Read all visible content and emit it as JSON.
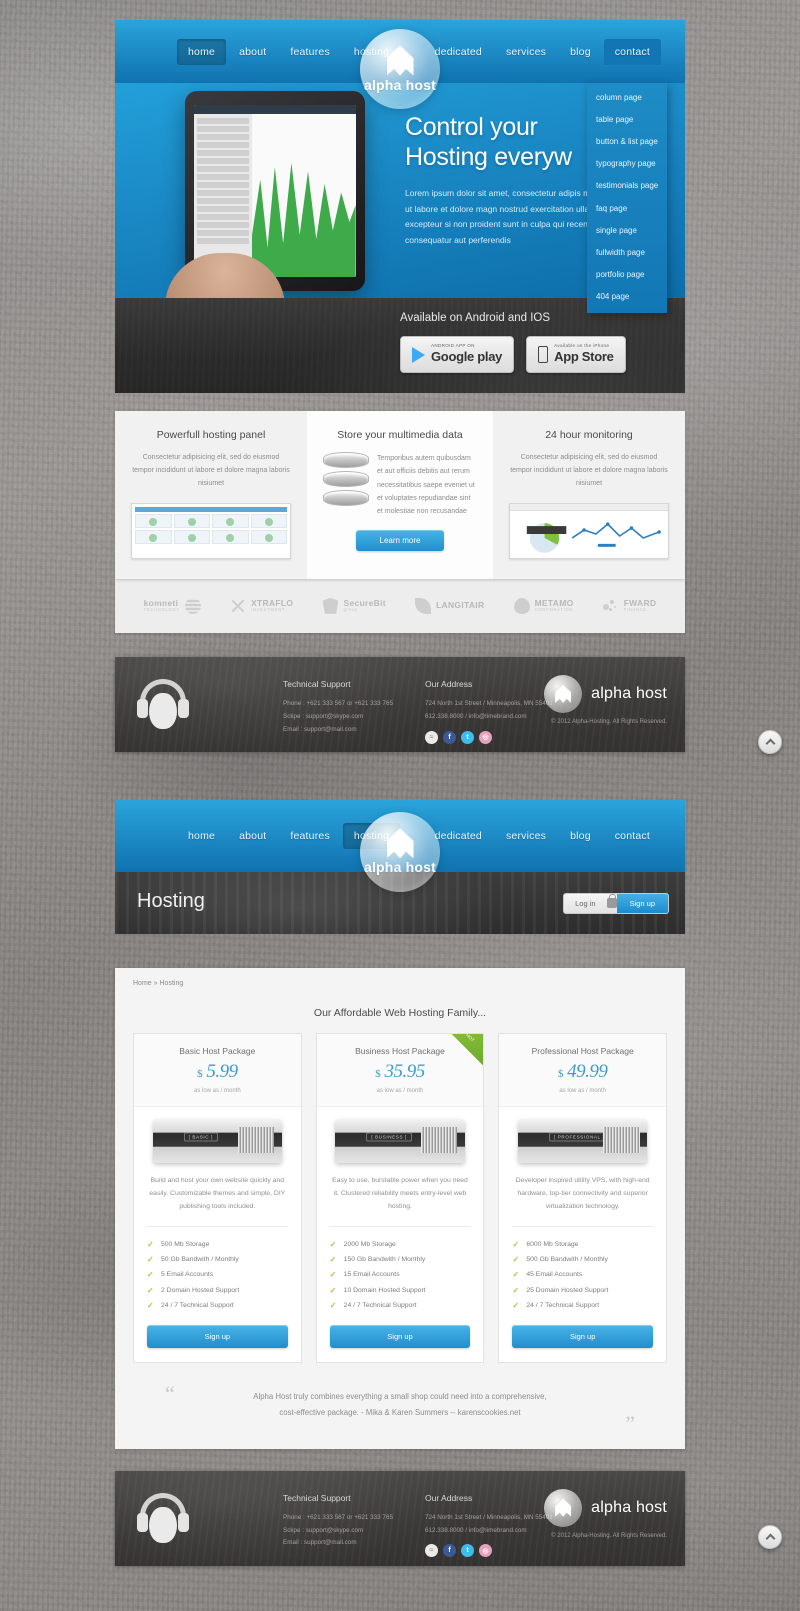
{
  "brand": {
    "name": "alpha host",
    "logo_icon": "alpha-host-logo-icon"
  },
  "nav": {
    "left": [
      {
        "label": "home",
        "state": "active"
      },
      {
        "label": "about",
        "state": ""
      },
      {
        "label": "features",
        "state": ""
      },
      {
        "label": "hosting",
        "state": ""
      }
    ],
    "right": [
      {
        "label": "dedicated",
        "state": ""
      },
      {
        "label": "services",
        "state": ""
      },
      {
        "label": "blog",
        "state": ""
      },
      {
        "label": "contact",
        "state": "open"
      }
    ],
    "dropdown": [
      "column page",
      "table page",
      "button & list page",
      "typography page",
      "testimonials page",
      "faq page",
      "single page",
      "fullwidth page",
      "portfolio page",
      "404 page"
    ]
  },
  "nav2": {
    "left": [
      {
        "label": "home",
        "state": ""
      },
      {
        "label": "about",
        "state": ""
      },
      {
        "label": "features",
        "state": ""
      },
      {
        "label": "hosting",
        "state": "active"
      }
    ],
    "right": [
      {
        "label": "dedicated",
        "state": ""
      },
      {
        "label": "services",
        "state": ""
      },
      {
        "label": "blog",
        "state": ""
      },
      {
        "label": "contact",
        "state": ""
      }
    ]
  },
  "hero": {
    "title_line1": "Control your",
    "title_line2": "Hosting everyw",
    "paragraph": "Lorem ipsum dolor sit amet, consectetur adipis mod tempor incididunt ut labore et dolore magn nostrud exercitation ullamco laboris excepteur si non proident sunt in culpa qui recends volupta consequatur aut perferendis",
    "prev_arrow": "‹",
    "next_arrow": "›"
  },
  "appbar": {
    "title": "Available on Android and IOS",
    "google_play": {
      "small": "ANDROID APP ON",
      "big": "Google play"
    },
    "app_store": {
      "small": "Available on the iPhone",
      "big": "App Store"
    }
  },
  "features": [
    {
      "title": "Powerfull hosting panel",
      "body": "Consectetur adipisicing elit, sed do eiusmod tempor incididunt ut labore et dolore magna laboris nisiumet"
    },
    {
      "title": "Store your multimedia data",
      "body": "Temporibus autem quibusdam et aut officiis debitis aut rerum necessitatibus saepe eveniet ut et voluptates repudiandae sint et molestiae non recusandae",
      "button": "Learn more"
    },
    {
      "title": "24 hour monitoring",
      "body": "Consectetur adipisicing elit, sed do eiusmod tempor incididunt ut labore et dolore magna laboris nisiumet"
    }
  ],
  "partners": [
    {
      "name": "komneti",
      "sub": "TECHNOLOGY",
      "icon": "globe-icon"
    },
    {
      "name": "XTRAFLO",
      "sub": "INVESTMENT",
      "icon": "x-cross-icon"
    },
    {
      "name": "SecureBit",
      "sub": "group",
      "icon": "shield-icon"
    },
    {
      "name": "LANGITAIR",
      "sub": "",
      "icon": "leaf-icon"
    },
    {
      "name": "METAMO",
      "sub": "CORPORATION",
      "icon": "flame-icon"
    },
    {
      "name": "FWARD",
      "sub": "FINANCE",
      "icon": "dots-icon"
    }
  ],
  "footer": {
    "support": {
      "heading": "Technical Support",
      "lines": [
        "Phone : +621 333 567 or +621 333 765",
        "Sckpe : support@skype.com",
        "Email : support@mail.com"
      ]
    },
    "address": {
      "heading": "Our Address",
      "lines": [
        "724 North 1st Street / Minneapolis, MN 55401",
        "612.338.8000 / info@limebrand.com"
      ]
    },
    "social": [
      {
        "name": "rss-icon",
        "glyph": "≈"
      },
      {
        "name": "facebook-icon",
        "glyph": "f"
      },
      {
        "name": "twitter-icon",
        "glyph": "t"
      },
      {
        "name": "dribbble-icon",
        "glyph": "◎"
      }
    ],
    "brand": "alpha host",
    "copyright": "© 2012 Alpha-Hosting. All Rights Reserved.",
    "headset_icon": "headset-icon"
  },
  "page": {
    "title": "Hosting",
    "login_label": "Log in",
    "signup_label": "Sign up",
    "lock_icon": "lock-icon",
    "breadcrumb": {
      "home": "Home",
      "sep": "»",
      "current": "Hosting"
    },
    "section_title": "Our Affordable Web Hosting Family..."
  },
  "plans": [
    {
      "name": "Basic Host Package",
      "currency": "$",
      "price": "5.99",
      "low_as": "as low as / month",
      "server_label": "[ BASIC ]",
      "description": "Build and host your own website quickly and easily. Customizable themes and simple, DIY publishing tools included.",
      "features": [
        "500 Mb Storage",
        "50 Gb Bandwith / Monthly",
        "5 Email Accounts",
        "2 Domain Hosted Support",
        "24 / 7 Technical Support"
      ],
      "cta": "Sign up",
      "ribbon": ""
    },
    {
      "name": "Business Host Package",
      "currency": "$",
      "price": "35.95",
      "low_as": "as low as / month",
      "server_label": "[ BUSINESS ]",
      "description": "Easy to use, burstable power when you need it. Clustered reliability meets entry-level web hosting.",
      "features": [
        "2000 Mb Storage",
        "150 Gb Bandwith / Monthly",
        "15 Email Accounts",
        "10 Domain Hosted Support",
        "24 / 7 Technical Support"
      ],
      "cta": "Sign up",
      "ribbon": "HOT"
    },
    {
      "name": "Professional Host Package",
      "currency": "$",
      "price": "49.99",
      "low_as": "as low as / month",
      "server_label": "[ PROFESSIONAL ]",
      "description": "Developer inspired utility VPS, with high-end hardware, top-tier connectivity and superior virtualization technology.",
      "features": [
        "6000 Mb Storage",
        "500 Gb Bandwith / Monthly",
        "45 Email Accounts",
        "25 Domain Hosted Support",
        "24 / 7 Technical Support"
      ],
      "cta": "Sign up",
      "ribbon": ""
    }
  ],
  "testimonial": {
    "open_quote": "“",
    "close_quote": "”",
    "line1": "Alpha Host truly combines everything a small shop could need into a comprehensive,",
    "line2": "cost-effective package. - Mika & Karen Summers -- karenscookies.net"
  },
  "scroll_top_icon": "chevron-up-icon"
}
